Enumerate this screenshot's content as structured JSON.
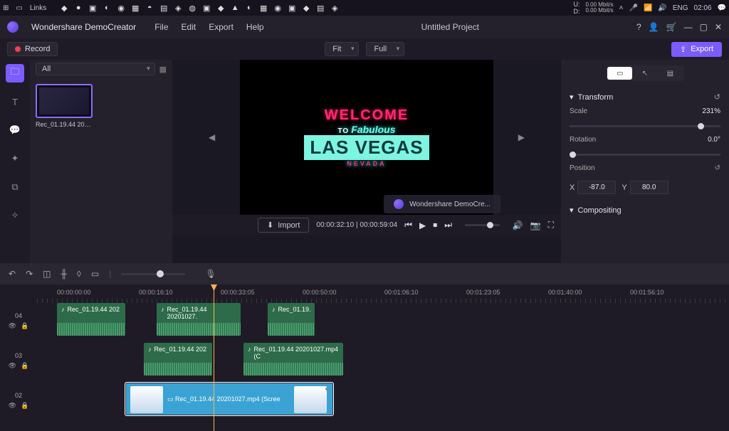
{
  "taskbar": {
    "links": "Links",
    "net_up": "0.00 Mbit/s",
    "net_down": "0.00 Mbit/s",
    "lang": "ENG",
    "clock": "02:06"
  },
  "menubar": {
    "app": "Wondershare DemoCreator",
    "file": "File",
    "edit": "Edit",
    "export": "Export",
    "help": "Help",
    "title": "Untitled Project"
  },
  "toolbar": {
    "record": "Record",
    "fit": "Fit",
    "full": "Full",
    "export_btn": "Export"
  },
  "media": {
    "all": "All",
    "import": "Import",
    "thumb_label": "Rec_01.19.44 2020..."
  },
  "preview": {
    "time": "00:00:32:10 | 00:00:59:04",
    "toast": "Wondershare DemoCre...",
    "sign_welcome": "WELCOME",
    "sign_to": "TO",
    "sign_fab": "Fabulous",
    "sign_lv": "LAS VEGAS",
    "sign_nv": "NEVADA"
  },
  "props": {
    "transform": "Transform",
    "scale": "Scale",
    "scale_val": "231%",
    "rotation": "Rotation",
    "rotation_val": "0.0°",
    "position": "Position",
    "x_label": "X",
    "x_val": "-87.0",
    "y_label": "Y",
    "y_val": "80.0",
    "compositing": "Compositing"
  },
  "timeline": {
    "ticks": [
      "00:00:00:00",
      "00:00:16:10",
      "00:00:33:05",
      "00:00:50:00",
      "00:01:06:10",
      "00:01:23:05",
      "00:01:40:00",
      "00:01:56:10"
    ],
    "track04": "04",
    "track03": "03",
    "track02": "02",
    "clips": {
      "a1": "Rec_01.19.44 202",
      "a2": "Rec_01.19.44 20201027.",
      "a3": "Rec_01.19.",
      "a4": "Rec_01.19.44 202",
      "a5": "Rec_01.19.44 20201027.mp4 (C",
      "v1": "Rec_01.19.44 20201027.mp4 (Scree"
    }
  }
}
